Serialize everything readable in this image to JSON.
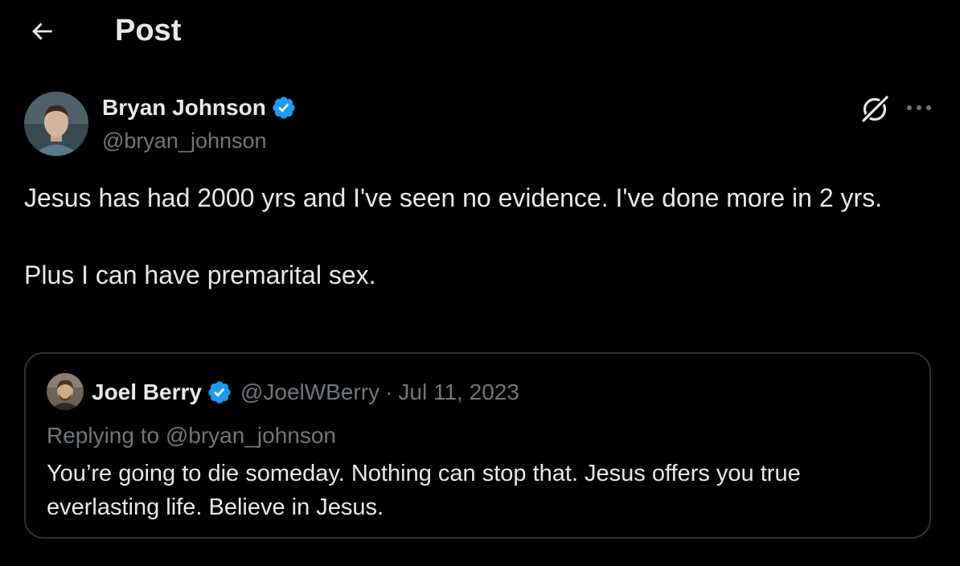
{
  "header": {
    "back_icon": "arrow-left-icon",
    "title": "Post"
  },
  "post": {
    "author": {
      "name": "Bryan Johnson",
      "handle": "@bryan_johnson",
      "verified_icon": "verified-badge-icon"
    },
    "text": "Jesus has had 2000 yrs and I've seen no evidence. I've done more in 2 yrs.\n\nPlus I can have premarital sex.",
    "actions": {
      "grok_icon": "grok-icon",
      "more_icon": "more-options-icon"
    }
  },
  "quote": {
    "author": {
      "name": "Joel Berry",
      "handle": "@JoelWBerry",
      "verified_icon": "verified-badge-icon"
    },
    "separator": "·",
    "date": "Jul 11, 2023",
    "reply_context": "Replying to @bryan_johnson",
    "text": "You’re going to die someday. Nothing can stop that. Jesus offers you true everlasting life. Believe in Jesus."
  },
  "colors": {
    "background": "#000000",
    "text_primary": "#e7e9ea",
    "text_secondary": "#71767b",
    "verified_blue": "#1d9bf0",
    "border": "#2f3336"
  }
}
